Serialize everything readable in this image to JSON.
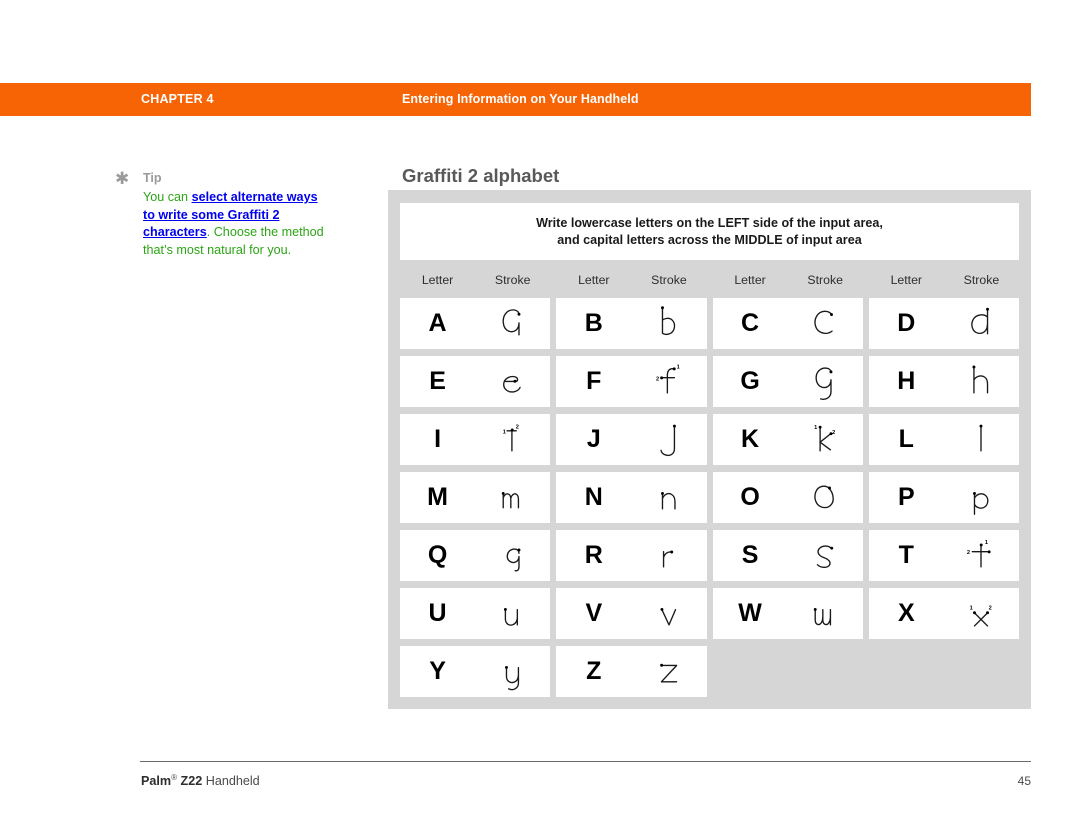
{
  "header": {
    "chapter_label": "CHAPTER 4",
    "chapter_title": "Entering Information on Your Handheld",
    "bar_color": "#F66406",
    "text_color": "#FFFFFF"
  },
  "tip": {
    "icon": "asterisk-icon",
    "heading": "Tip",
    "text_before": "You can ",
    "link_text": "select alternate ways to write some Graffiti 2 characters",
    "text_after": ". Choose the method that’s most natural for you.",
    "link_color": "#2BA514",
    "heading_color": "#9A9A9A"
  },
  "section": {
    "heading": "Graffiti 2 alphabet",
    "heading_color": "#595959",
    "panel_color": "#D6D6D6"
  },
  "instruction": {
    "line1": "Write lowercase letters on the LEFT side of the input area,",
    "line2": "and capital letters across the MIDDLE of input area"
  },
  "table": {
    "column_headers": [
      "Letter",
      "Stroke",
      "Letter",
      "Stroke",
      "Letter",
      "Stroke",
      "Letter",
      "Stroke"
    ],
    "rows": [
      [
        {
          "letter": "A",
          "stroke": "a"
        },
        {
          "letter": "B",
          "stroke": "b"
        },
        {
          "letter": "C",
          "stroke": "c"
        },
        {
          "letter": "D",
          "stroke": "d"
        }
      ],
      [
        {
          "letter": "E",
          "stroke": "e"
        },
        {
          "letter": "F",
          "stroke": "f"
        },
        {
          "letter": "G",
          "stroke": "g"
        },
        {
          "letter": "H",
          "stroke": "h"
        }
      ],
      [
        {
          "letter": "I",
          "stroke": "i"
        },
        {
          "letter": "J",
          "stroke": "j"
        },
        {
          "letter": "K",
          "stroke": "k"
        },
        {
          "letter": "L",
          "stroke": "l"
        }
      ],
      [
        {
          "letter": "M",
          "stroke": "m"
        },
        {
          "letter": "N",
          "stroke": "n"
        },
        {
          "letter": "O",
          "stroke": "o"
        },
        {
          "letter": "P",
          "stroke": "p"
        }
      ],
      [
        {
          "letter": "Q",
          "stroke": "q"
        },
        {
          "letter": "R",
          "stroke": "r"
        },
        {
          "letter": "S",
          "stroke": "s"
        },
        {
          "letter": "T",
          "stroke": "t"
        }
      ],
      [
        {
          "letter": "U",
          "stroke": "u"
        },
        {
          "letter": "V",
          "stroke": "v"
        },
        {
          "letter": "W",
          "stroke": "w"
        },
        {
          "letter": "X",
          "stroke": "x"
        }
      ],
      [
        {
          "letter": "Y",
          "stroke": "y"
        },
        {
          "letter": "Z",
          "stroke": "z"
        }
      ]
    ],
    "stroke_order_numbers": {
      "f": [
        "1",
        "2"
      ],
      "i": [
        "1",
        "2"
      ],
      "k": [
        "1",
        "2"
      ],
      "t": [
        "1",
        "2"
      ],
      "x": [
        "1",
        "2"
      ]
    }
  },
  "footer": {
    "brand": "Palm",
    "registered": "®",
    "model": "Z22",
    "product": "Handheld",
    "page_number": "45"
  }
}
